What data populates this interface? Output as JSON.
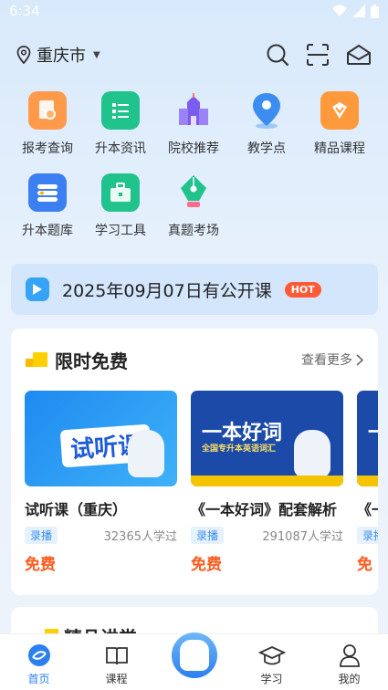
{
  "status": {
    "time": "6:34"
  },
  "header": {
    "city": "重庆市"
  },
  "grid": [
    {
      "label": "报考查询",
      "icon": "search-doc-icon"
    },
    {
      "label": "升本资讯",
      "icon": "news-icon"
    },
    {
      "label": "院校推荐",
      "icon": "school-icon"
    },
    {
      "label": "教学点",
      "icon": "location-pin-icon"
    },
    {
      "label": "精品课程",
      "icon": "course-icon"
    },
    {
      "label": "升本题库",
      "icon": "question-bank-icon"
    },
    {
      "label": "学习工具",
      "icon": "toolbox-icon"
    },
    {
      "label": "真题考场",
      "icon": "pen-nib-icon"
    }
  ],
  "notice": {
    "text": "2025年09月07日有公开课",
    "badge": "HOT"
  },
  "free": {
    "title": "限时免费",
    "more": "查看更多",
    "cards": [
      {
        "thumb_text": "试听课",
        "title": "试听课（重庆）",
        "tag": "录播",
        "count": "32365人学过",
        "price": "免费"
      },
      {
        "thumb_text": "一本好词",
        "thumb_sub": "全国专升本英语词汇",
        "title": "《一本好词》配套解析",
        "tag": "录播",
        "count": "291087人学过",
        "price": "免费"
      },
      {
        "thumb_text": "一本",
        "title": "《一",
        "tag": "录播",
        "count": "",
        "price": "免"
      }
    ]
  },
  "peek": {
    "title": "精品讲堂"
  },
  "tabs": [
    {
      "label": "首页",
      "icon": "home-icon"
    },
    {
      "label": "课程",
      "icon": "book-icon"
    },
    {
      "label": "",
      "icon": "mascot-icon"
    },
    {
      "label": "学习",
      "icon": "graduation-cap-icon"
    },
    {
      "label": "我的",
      "icon": "user-icon"
    }
  ],
  "colors": {
    "accent": "#2b7ff0",
    "price": "#ff5a1f",
    "hot": "#ff5a35"
  }
}
